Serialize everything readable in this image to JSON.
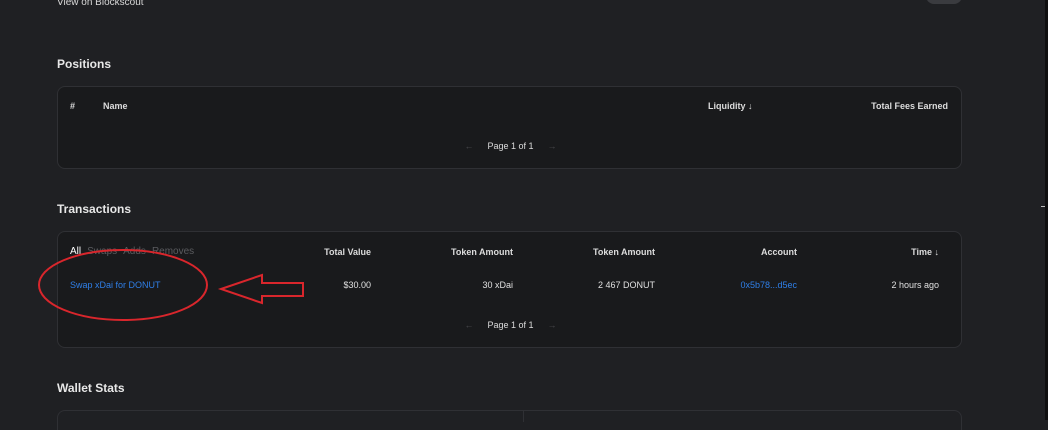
{
  "header": {
    "blockscout_link": "View on Blockscout"
  },
  "positions": {
    "title": "Positions",
    "columns": {
      "index": "#",
      "name": "Name",
      "liquidity": "Liquidity ↓",
      "fees": "Total Fees Earned"
    },
    "pager": {
      "prev": "←",
      "label": "Page 1 of 1",
      "next": "→"
    }
  },
  "transactions": {
    "title": "Transactions",
    "filters": {
      "all": "All",
      "swaps": "Swaps",
      "adds": "Adds",
      "removes": "Removes"
    },
    "columns": {
      "total_value": "Total Value",
      "token_amount_1": "Token Amount",
      "token_amount_2": "Token Amount",
      "account": "Account",
      "time": "Time ↓"
    },
    "rows": [
      {
        "action": "Swap xDai for DONUT",
        "total_value": "$30.00",
        "token_amount_1": "30 xDai",
        "token_amount_2": "2 467 DONUT",
        "account": "0x5b78...d5ec",
        "time": "2 hours ago"
      }
    ],
    "pager": {
      "prev": "←",
      "label": "Page 1 of 1",
      "next": "→"
    }
  },
  "wallet_stats": {
    "title": "Wallet Stats"
  },
  "annotation": {
    "color": "#d9262c"
  },
  "colors": {
    "background": "#1f2023",
    "card": "#191a1c",
    "link": "#2f7fe8"
  }
}
